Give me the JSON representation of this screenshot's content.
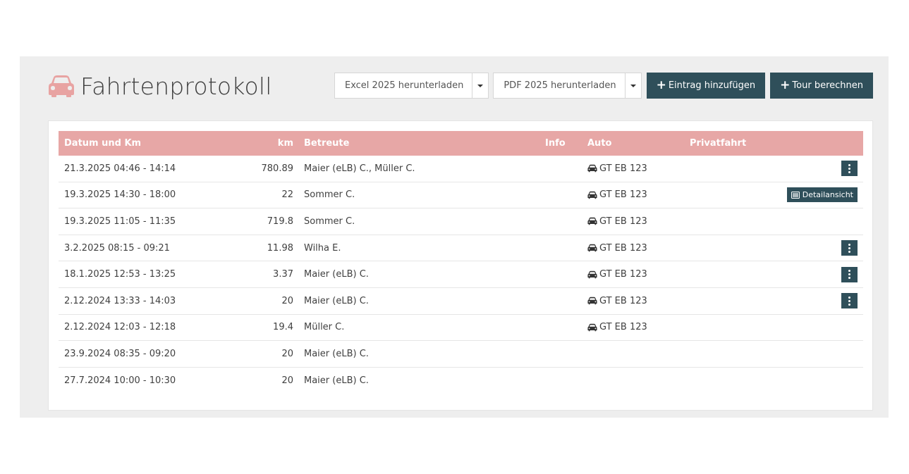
{
  "header": {
    "title": "Fahrtenprotokoll",
    "title_icon": "car-icon",
    "title_icon_color": "#e8a3a2"
  },
  "toolbar": {
    "excel_label": "Excel 2025 herunterladen",
    "pdf_label": "PDF 2025 herunterladen",
    "add_entry_label": "Eintrag hinzufügen",
    "calc_tour_label": "Tour berechnen"
  },
  "table": {
    "columns": {
      "date": "Datum und Km",
      "km": "km",
      "betreute": "Betreute",
      "info": "Info",
      "auto": "Auto",
      "privatfahrt": "Privatfahrt"
    },
    "detail_label": "Detailansicht",
    "rows": [
      {
        "date": "21.3.2025 04:46 - 14:14",
        "km": "780.89",
        "betreute": "Maier (eLB) C., Müller C.",
        "auto": "GT EB 123",
        "action": "menu"
      },
      {
        "date": "19.3.2025 14:30 - 18:00",
        "km": "22",
        "betreute": "Sommer C.",
        "auto": "GT EB 123",
        "action": "detail"
      },
      {
        "date": "19.3.2025 11:05 - 11:35",
        "km": "719.8",
        "betreute": "Sommer C.",
        "auto": "GT EB 123",
        "action": "none"
      },
      {
        "date": "3.2.2025 08:15 - 09:21",
        "km": "11.98",
        "betreute": "Wilha E.",
        "auto": "GT EB 123",
        "action": "menu"
      },
      {
        "date": "18.1.2025 12:53 - 13:25",
        "km": "3.37",
        "betreute": "Maier (eLB) C.",
        "auto": "GT EB 123",
        "action": "menu"
      },
      {
        "date": "2.12.2024 13:33 - 14:03",
        "km": "20",
        "betreute": "Maier (eLB) C.",
        "auto": "GT EB 123",
        "action": "menu"
      },
      {
        "date": "2.12.2024 12:03 - 12:18",
        "km": "19.4",
        "betreute": "Müller C.",
        "auto": "GT EB 123",
        "action": "none"
      },
      {
        "date": "23.9.2024 08:35 - 09:20",
        "km": "20",
        "betreute": "Maier (eLB) C.",
        "auto": "",
        "action": "none"
      },
      {
        "date": "27.7.2024 10:00 - 10:30",
        "km": "20",
        "betreute": "Maier (eLB) C.",
        "auto": "",
        "action": "none"
      }
    ]
  },
  "colors": {
    "header_row": "#e7a7a6",
    "button_dark": "#2f4f5a",
    "panel_bg": "#eeeeee"
  }
}
